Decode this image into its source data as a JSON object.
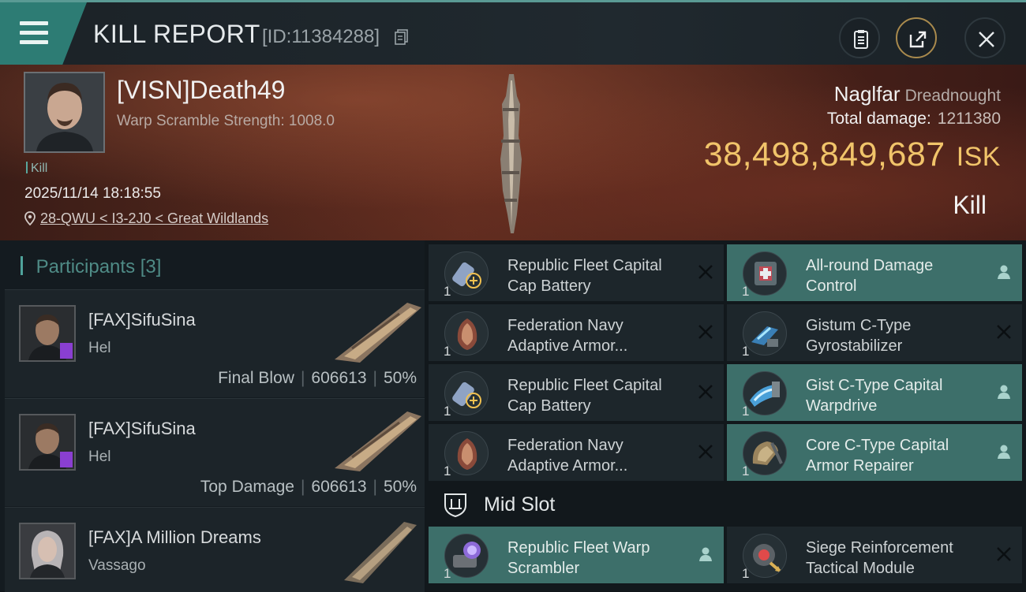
{
  "header": {
    "title": "KILL REPORT",
    "report_id": "[ID:11384288]"
  },
  "victim": {
    "name": "[VISN]Death49",
    "warp_scramble": "Warp Scramble Strength: 1008.0",
    "status_tag": "Kill",
    "datetime": "2025/11/14 18:18:55",
    "location": "28-QWU < I3-2J0 < Great Wildlands",
    "ship_name": "Naglfar",
    "ship_class": "Dreadnought",
    "total_damage_label": "Total damage:",
    "total_damage_value": "1211380",
    "isk_value": "38,498,849,687",
    "isk_unit": "ISK",
    "result_label": "Kill"
  },
  "participants": {
    "label": "Participants",
    "count": "[3]",
    "rows": [
      {
        "name": "[FAX]SifuSina",
        "ship": "Hel",
        "role": "Final Blow",
        "damage": "606613",
        "percent": "50%"
      },
      {
        "name": "[FAX]SifuSina",
        "ship": "Hel",
        "role": "Top Damage",
        "damage": "606613",
        "percent": "50%"
      },
      {
        "name": "[FAX]A Million Dreams",
        "ship": "Vassago"
      }
    ]
  },
  "modules": {
    "items": [
      {
        "name": "Republic Fleet Capital Cap Battery",
        "line1": "Republic Fleet Capital",
        "line2": "Cap Battery",
        "qty": "1",
        "state": "destroyed"
      },
      {
        "name": "All-round Damage Control",
        "line1": "All-round Damage",
        "line2": "Control",
        "qty": "1",
        "state": "dropped"
      },
      {
        "name": "Federation Navy Adaptive Armor...",
        "line1": "Federation Navy",
        "line2": "Adaptive Armor...",
        "qty": "1",
        "state": "destroyed"
      },
      {
        "name": "Gistum C-Type Gyrostabilizer",
        "line1": "Gistum C-Type",
        "line2": "Gyrostabilizer",
        "qty": "1",
        "state": "destroyed"
      },
      {
        "name": "Republic Fleet Capital Cap Battery",
        "line1": "Republic Fleet Capital",
        "line2": "Cap Battery",
        "qty": "1",
        "state": "destroyed"
      },
      {
        "name": "Gist C-Type Capital Warpdrive",
        "line1": "Gist C-Type Capital",
        "line2": "Warpdrive",
        "qty": "1",
        "state": "dropped"
      },
      {
        "name": "Federation Navy Adaptive Armor...",
        "line1": "Federation Navy",
        "line2": "Adaptive Armor...",
        "qty": "1",
        "state": "destroyed"
      },
      {
        "name": "Core C-Type Capital Armor Repairer",
        "line1": "Core C-Type Capital",
        "line2": "Armor Repairer",
        "qty": "1",
        "state": "dropped"
      }
    ],
    "mid_slot_label": "Mid Slot",
    "mid_items": [
      {
        "name": "Republic Fleet Warp Scrambler",
        "line1": "Republic Fleet Warp",
        "line2": "Scrambler",
        "qty": "1",
        "state": "dropped"
      },
      {
        "name": "Siege Reinforcement Tactical Module",
        "line1": "Siege Reinforcement",
        "line2": "Tactical Module",
        "qty": "1",
        "state": "destroyed"
      }
    ]
  },
  "colors": {
    "accent": "#2d7c74",
    "isk_gold": "#f1c46a",
    "dropped_bg": "#3d6f6a",
    "destroyed_bg": "#1d262b"
  },
  "icons": {
    "menu": "hamburger-icon",
    "copy": "copy-icon",
    "clipboard": "clipboard-icon",
    "share": "share-icon",
    "close": "close-icon",
    "location": "location-pin-icon",
    "destroyed": "x-icon",
    "dropped": "person-icon",
    "mid_slot": "shield-slot-icon"
  }
}
